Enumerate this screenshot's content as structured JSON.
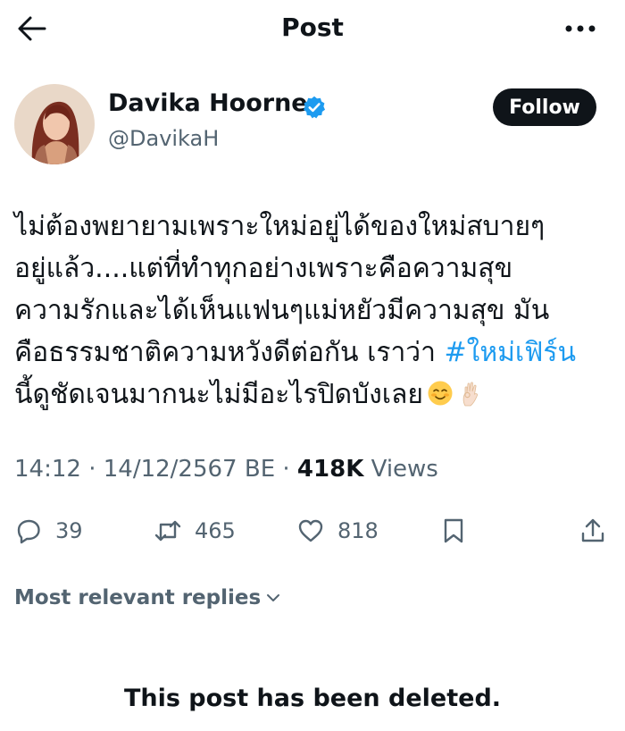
{
  "header": {
    "title": "Post",
    "back_icon": "arrow-left-icon",
    "more_icon": "more-horizontal-icon"
  },
  "author": {
    "name": "Davika Hoorne",
    "handle": "@DavikaH",
    "verified": true,
    "verified_color": "#1d9bf0",
    "follow_label": "Follow"
  },
  "tweet": {
    "line1": "ไม่ต้องพยายามเพราะใหม่อยู่ได้ของใหม่สบายๆ",
    "line2": "อยู่แล้ว....แต่ที่ทำทุกอย่างเพราะคือความสุข",
    "line3": "ความรักและได้เห็นแฟนๆแม่หยัวมีความสุข มัน",
    "line4_text": "คือธรรมชาติความหวังดีต่อกัน เราว่า ",
    "hashtag": "#ใหม่เฟิร์น",
    "line5": "นี้ดูชัดเจนมากนะไม่มีอะไรปิดบังเลย",
    "emojis": [
      "smiling-face-emoji",
      "ok-hand-emoji"
    ],
    "hashtag_color": "#1d9bf0"
  },
  "meta": {
    "time": "14:12",
    "separator": " · ",
    "date": "14/12/2567 BE",
    "views_count": "418K",
    "views_label": "Views"
  },
  "actions": {
    "replies": "39",
    "reposts": "465",
    "likes": "818",
    "icons": [
      "reply-icon",
      "repost-icon",
      "like-icon",
      "bookmark-icon",
      "share-icon"
    ]
  },
  "replies": {
    "sort_label": "Most relevant replies"
  },
  "notice": {
    "text": "This post has been deleted."
  },
  "colors": {
    "text": "#0f1419",
    "secondary": "#536471",
    "accent": "#1d9bf0"
  }
}
